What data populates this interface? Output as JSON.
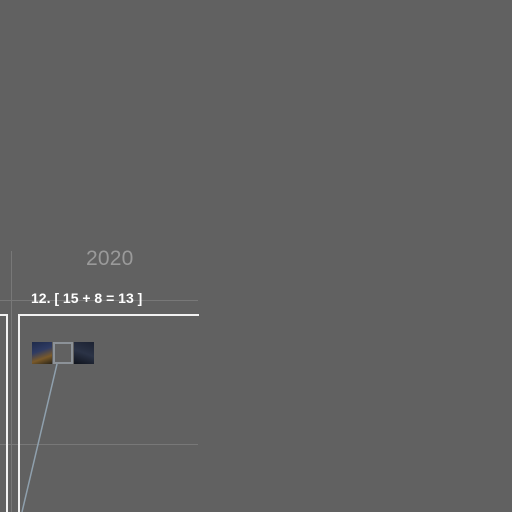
{
  "timeline": {
    "year_label": "2020",
    "cell": {
      "title": "12. [ 15 + 8 = 13 ]",
      "thumbnails": [
        {
          "name": "thumbnail-night-scene"
        },
        {
          "name": "thumbnail-selected-empty"
        },
        {
          "name": "thumbnail-dark-scene"
        }
      ]
    }
  },
  "colors": {
    "background": "#616161",
    "grid_line": "#787878",
    "frame": "#f2f2f2",
    "year_text": "#9a9a9a",
    "title_text": "#ffffff",
    "connector": "#8fa0ad"
  }
}
